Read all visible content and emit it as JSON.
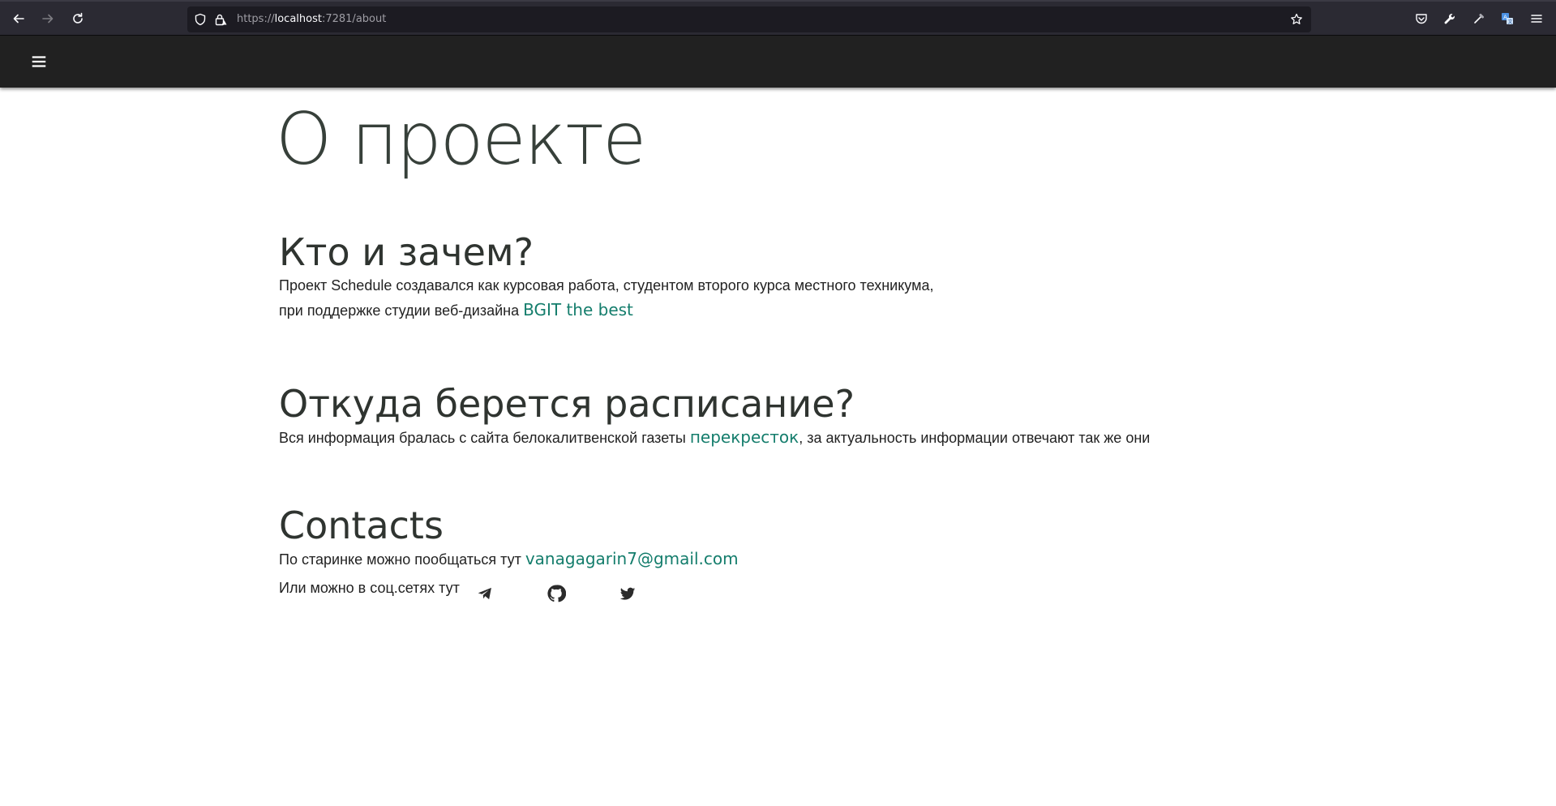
{
  "browser": {
    "url_scheme": "https://",
    "url_host": "localhost",
    "url_path": ":7281/about",
    "icons": {
      "back": "arrow-left-icon",
      "forward": "arrow-right-icon",
      "reload": "reload-icon",
      "shield": "tracking-shield-icon",
      "lock": "insecure-lock-icon",
      "bookmark": "star-icon",
      "pocket": "pocket-icon",
      "tools": "wrench-icon",
      "eyedropper": "eyedropper-icon",
      "translate": "translate-icon",
      "menu": "hamburger-icon"
    }
  },
  "nav": {
    "menu_icon": "hamburger-icon"
  },
  "page": {
    "title": "О проекте",
    "sections": [
      {
        "heading": "Кто и зачем?",
        "line1": "Проект Schedule создавался как курсовая работа, студентом второго курса местного техникума,",
        "line2_prefix": "при поддержке студии веб-дизайна ",
        "link": "BGIT the best"
      },
      {
        "heading": "Откуда берется расписание?",
        "prefix": "Вся информация бралась с сайта белокалитвенской газеты ",
        "link": "перекресток",
        "suffix": ", за актуальность информации отвечают так же они"
      },
      {
        "heading": "Contacts",
        "email_prefix": "По старинке можно пообщаться тут ",
        "email": "vanagagarin7@gmail.com",
        "social_prefix": "Или можно в соц.сетях тут",
        "social_icons": [
          "telegram-icon",
          "github-icon",
          "twitter-icon"
        ]
      }
    ]
  },
  "colors": {
    "link": "#147d6c",
    "nav_bg": "#212121",
    "browser_bg": "#2b2a33"
  }
}
